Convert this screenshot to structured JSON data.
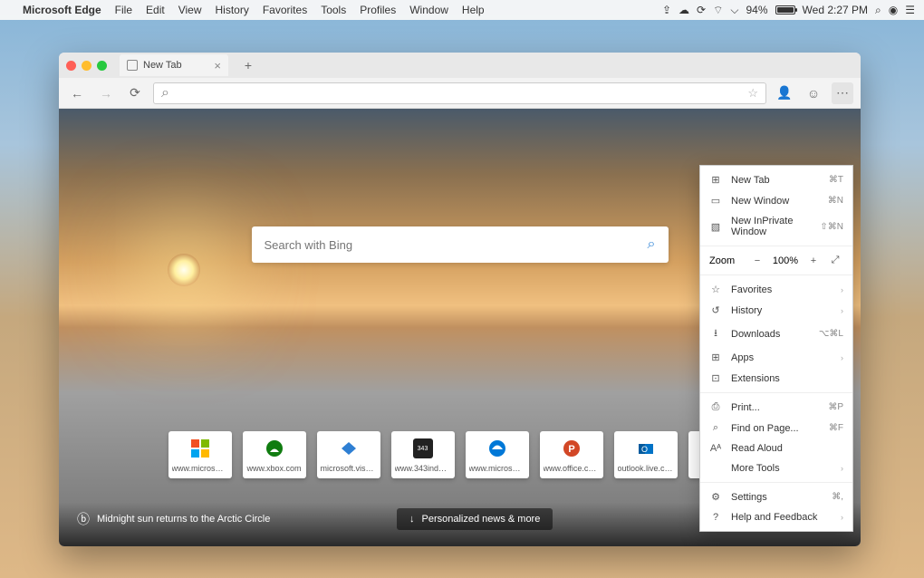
{
  "menubar": {
    "app": "Microsoft Edge",
    "items": [
      "File",
      "Edit",
      "View",
      "History",
      "Favorites",
      "Tools",
      "Profiles",
      "Window",
      "Help"
    ],
    "battery": "94%",
    "clock": "Wed 2:27 PM"
  },
  "tab": {
    "title": "New Tab"
  },
  "search": {
    "placeholder": "Search with Bing"
  },
  "tiles": [
    {
      "label": "www.microsoft...",
      "color": "#fff",
      "kind": "ms"
    },
    {
      "label": "www.xbox.com",
      "color": "#fff",
      "kind": "xbox"
    },
    {
      "label": "microsoft.visua...",
      "color": "#fff",
      "kind": "vs"
    },
    {
      "label": "www.343indus...",
      "color": "#222",
      "kind": "343"
    },
    {
      "label": "www.microsoft...",
      "color": "#fff",
      "kind": "edge"
    },
    {
      "label": "www.office.com",
      "color": "#fff",
      "kind": "ppt"
    },
    {
      "label": "outlook.live.com",
      "color": "#fff",
      "kind": "outlook"
    }
  ],
  "footer": {
    "caption": "Midnight sun returns to the Arctic Circle",
    "news_btn": "Personalized news & more"
  },
  "menu": {
    "sections": [
      [
        {
          "icon": "⊞",
          "label": "New Tab",
          "sc": "⌘T"
        },
        {
          "icon": "▭",
          "label": "New Window",
          "sc": "⌘N"
        },
        {
          "icon": "▧",
          "label": "New InPrivate Window",
          "sc": "⇧⌘N"
        }
      ],
      [
        {
          "zoom": true,
          "label": "Zoom",
          "value": "100%"
        }
      ],
      [
        {
          "icon": "☆",
          "label": "Favorites",
          "chev": true
        },
        {
          "icon": "↺",
          "label": "History",
          "chev": true
        },
        {
          "icon": "⭳",
          "label": "Downloads",
          "sc": "⌥⌘L"
        },
        {
          "icon": "⊞",
          "label": "Apps",
          "chev": true
        },
        {
          "icon": "⊡",
          "label": "Extensions"
        }
      ],
      [
        {
          "icon": "⎙",
          "label": "Print...",
          "sc": "⌘P"
        },
        {
          "icon": "⌕",
          "label": "Find on Page...",
          "sc": "⌘F"
        },
        {
          "icon": "Aᴬ",
          "label": "Read Aloud"
        },
        {
          "icon": "",
          "label": "More Tools",
          "chev": true
        }
      ],
      [
        {
          "icon": "⚙",
          "label": "Settings",
          "sc": "⌘,"
        },
        {
          "icon": "?",
          "label": "Help and Feedback",
          "chev": true
        }
      ]
    ]
  }
}
